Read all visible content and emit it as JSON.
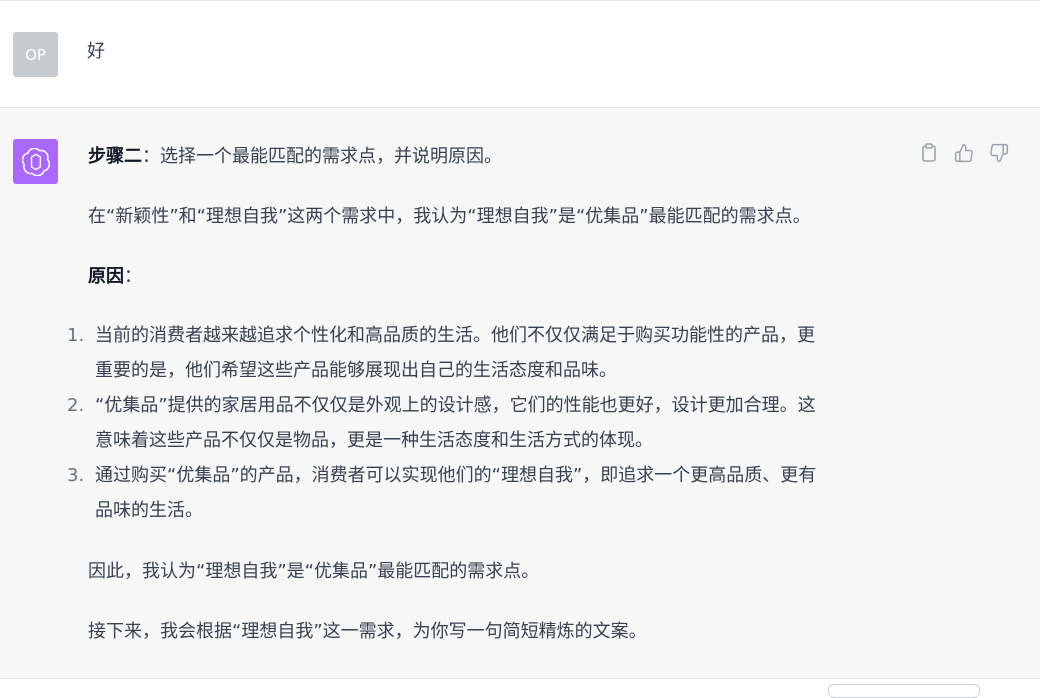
{
  "user_message": {
    "avatar_initials": "OP",
    "text": "好"
  },
  "assistant_message": {
    "step_label": "步骤二",
    "step_text": "：选择一个最能匹配的需求点，并说明原因。",
    "intro": "在“新颖性”和“理想自我”这两个需求中，我认为“理想自我”是“优集品”最能匹配的需求点。",
    "reason_label": "原因",
    "reason_colon": "：",
    "list_items": [
      {
        "number": "1.",
        "line1": "当前的消费者越来越追求个性化和高品质的生活。他们不仅仅满足于购买功能性的产品，更",
        "line2": "重要的是，他们希望这些产品能够展现出自己的生活态度和品味。"
      },
      {
        "number": "2.",
        "line1": "“优集品”提供的家居用品不仅仅是外观上的设计感，它们的性能也更好，设计更加合理。这",
        "line2": "意味着这些产品不仅仅是物品，更是一种生活态度和生活方式的体现。"
      },
      {
        "number": "3.",
        "line1": "通过购买“优集品”的产品，消费者可以实现他们的“理想自我”，即追求一个更高品质、更有",
        "line2": "品味的生活。"
      }
    ],
    "conclusion": "因此，我认为“理想自我”是“优集品”最能匹配的需求点。",
    "next_step": "接下来，我会根据“理想自我”这一需求，为你写一句简短精炼的文案。"
  },
  "actions": {
    "icons": [
      "clipboard-icon",
      "thumbs-up-icon",
      "thumbs-down-icon"
    ]
  },
  "colors": {
    "assistant_bg": "#f7f7f8",
    "gpt_avatar": "#ab68ff",
    "user_avatar": "#c7cbd1"
  }
}
